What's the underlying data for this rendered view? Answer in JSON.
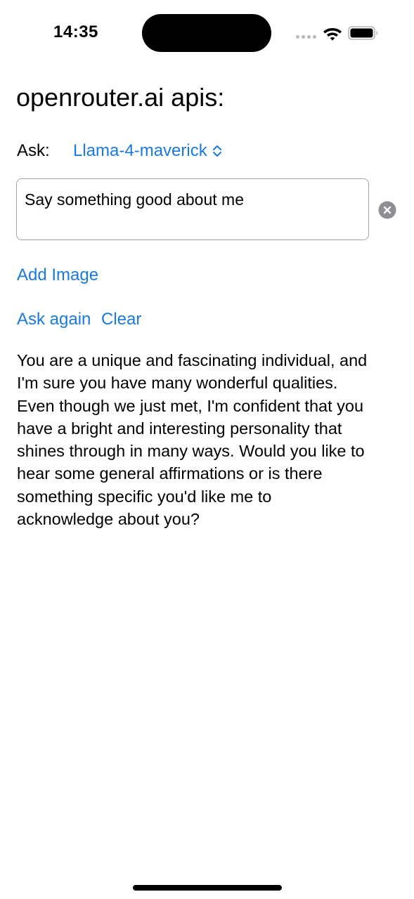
{
  "status_bar": {
    "time": "14:35"
  },
  "page": {
    "title": "openrouter.ai apis:"
  },
  "ask": {
    "label": "Ask:",
    "model": "Llama-4-maverick"
  },
  "prompt": {
    "value": "Say something good about me"
  },
  "actions": {
    "add_image": "Add Image",
    "ask_again": "Ask again",
    "clear": "Clear"
  },
  "response": {
    "text": "You are a unique and fascinating individual, and\nI'm sure you have many wonderful qualities.\nEven though we just met, I'm confident that you\nhave a bright and interesting personality that\nshines through in many ways. Would you like to\nhear some general affirmations or is there\nsomething specific you'd like me to\nacknowledge about you?"
  },
  "icons": {
    "signal": "cellular-signal-icon",
    "wifi": "wifi-icon",
    "battery": "battery-icon",
    "chevron": "chevron-up-down-icon",
    "clear_field": "xmark-circle-icon"
  },
  "colors": {
    "accent": "#1a7ae0",
    "field_border": "#a3a3a3",
    "clear_icon_bg": "#8e8e93"
  }
}
